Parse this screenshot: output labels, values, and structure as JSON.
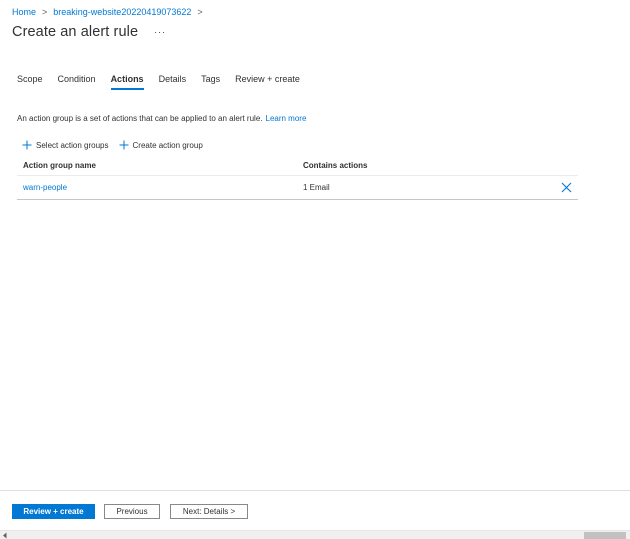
{
  "breadcrumb": {
    "home": "Home",
    "separator": ">",
    "resource": "breaking-website20220419073622"
  },
  "header": {
    "title": "Create an alert rule",
    "more": "···"
  },
  "tabs": [
    {
      "label": "Scope",
      "active": false
    },
    {
      "label": "Condition",
      "active": false
    },
    {
      "label": "Actions",
      "active": true
    },
    {
      "label": "Details",
      "active": false
    },
    {
      "label": "Tags",
      "active": false
    },
    {
      "label": "Review + create",
      "active": false
    }
  ],
  "actions": {
    "description": "An action group is a set of actions that can be applied to an alert rule.",
    "learn_more": "Learn more",
    "commands": {
      "select": "Select action groups",
      "create": "Create action group"
    },
    "table": {
      "columns": [
        "Action group name",
        "Contains actions"
      ],
      "rows": [
        {
          "name": "warn-people",
          "contains": "1 Email"
        }
      ]
    }
  },
  "footer": {
    "review_create": "Review + create",
    "previous": "Previous",
    "next": "Next: Details >"
  },
  "colors": {
    "accent": "#0078d4",
    "text": "#323130",
    "border": "#c8c6c4"
  }
}
